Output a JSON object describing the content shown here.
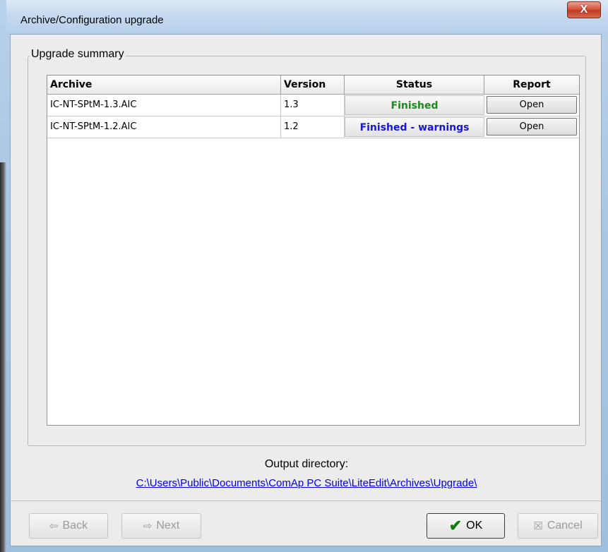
{
  "window": {
    "title": "Archive/Configuration upgrade",
    "close_label": "X"
  },
  "summary": {
    "group_label": "Upgrade summary",
    "columns": [
      "Archive",
      "Version",
      "Status",
      "Report"
    ],
    "rows": [
      {
        "archive": "IC-NT-SPtM-1.3.AIC",
        "version": "1.3",
        "status": "Finished",
        "status_color": "#1a8a1a",
        "report": "Open"
      },
      {
        "archive": "IC-NT-SPtM-1.2.AIC",
        "version": "1.2",
        "status": "Finished - warnings",
        "status_color": "#1515e0",
        "report": "Open"
      }
    ]
  },
  "output": {
    "label": "Output directory:",
    "path": "C:\\Users\\Public\\Documents\\ComAp PC Suite\\LiteEdit\\Archives\\Upgrade\\"
  },
  "buttons": {
    "back": {
      "label": "Back",
      "icon": "left-arrow-icon",
      "glyph": "⇦",
      "enabled": false
    },
    "next": {
      "label": "Next",
      "icon": "right-arrow-icon",
      "glyph": "⇨",
      "enabled": false
    },
    "ok": {
      "label": "OK",
      "icon": "checkmark-icon",
      "glyph": "✔",
      "enabled": true
    },
    "cancel": {
      "label": "Cancel",
      "icon": "cancel-x-icon",
      "glyph": "☒",
      "enabled": false
    }
  }
}
